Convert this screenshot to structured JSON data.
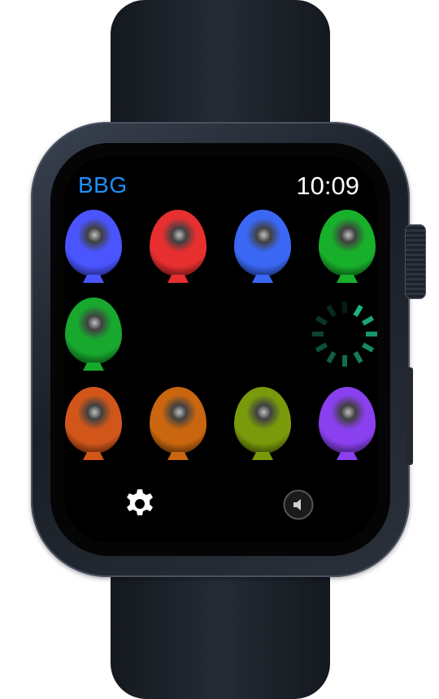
{
  "header": {
    "app_title": "BBG",
    "time": "10:09"
  },
  "colors": {
    "title": "#1e90ff",
    "spinner": "#1fbf8f"
  },
  "balloons": [
    {
      "color": "blue",
      "hex": "#4a55ff"
    },
    {
      "color": "red",
      "hex": "#e82f30"
    },
    {
      "color": "blue",
      "hex": "#3a68f5"
    },
    {
      "color": "green",
      "hex": "#18b02a"
    },
    {
      "color": "green",
      "hex": "#18a82e"
    },
    {
      "color": "orange",
      "hex": "#d2561a"
    },
    {
      "color": "orange",
      "hex": "#c9660f"
    },
    {
      "color": "olive",
      "hex": "#7a9a0c"
    },
    {
      "color": "purple",
      "hex": "#8a40ee"
    }
  ],
  "controls": {
    "settings_icon": "gear-icon",
    "sound_icon": "speaker-icon",
    "loading_icon": "activity-spinner-icon"
  }
}
